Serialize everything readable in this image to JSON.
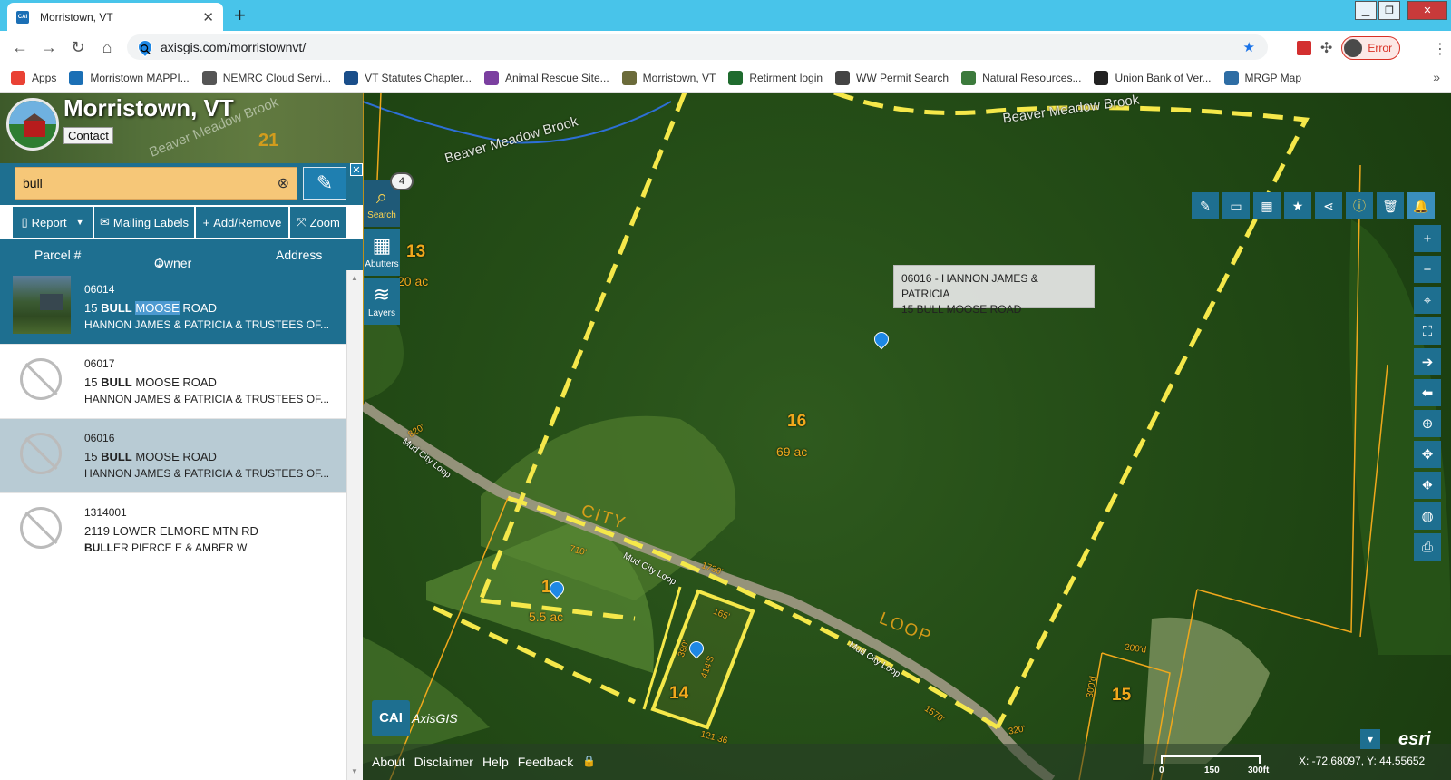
{
  "browser": {
    "tab_title": "Morristown, VT",
    "url": "axisgis.com/morristownvt/",
    "profile_label": "Error",
    "bookmarks": [
      {
        "label": "Apps",
        "color": "#e94235"
      },
      {
        "label": "Morristown MAPPI...",
        "color": "#1b6fb5"
      },
      {
        "label": "NEMRC Cloud Servi...",
        "color": "#555555"
      },
      {
        "label": "VT Statutes Chapter...",
        "color": "#1a4e8a"
      },
      {
        "label": "Animal Rescue Site...",
        "color": "#7b3fa0"
      },
      {
        "label": "Morristown, VT",
        "color": "#6b6b3a"
      },
      {
        "label": "Retirment login",
        "color": "#1f6b2e"
      },
      {
        "label": "WW Permit Search",
        "color": "#444444"
      },
      {
        "label": "Natural Resources...",
        "color": "#3c7a3c"
      },
      {
        "label": "Union Bank of Ver...",
        "color": "#222222"
      },
      {
        "label": "MRGP Map",
        "color": "#2e6da4"
      }
    ]
  },
  "app": {
    "title": "Morristown, VT",
    "contact_label": "Contact",
    "banner_parcel": "21",
    "banner_brook": "Beaver Meadow Brook"
  },
  "search": {
    "value": "bull",
    "result_count": "4"
  },
  "actions": {
    "report": "Report",
    "mailing_labels": "Mailing Labels",
    "add_remove": "Add/Remove",
    "zoom": "Zoom"
  },
  "columns": {
    "parcel": "Parcel #",
    "owner": "Owner",
    "address": "Address"
  },
  "results": [
    {
      "parcel": "06014",
      "address_pre": "15 ",
      "address_bold": "BULL",
      "address_hl": "MOOSE",
      "address_post": " ROAD",
      "owner": "HANNON JAMES & PATRICIA & TRUSTEES OF..."
    },
    {
      "parcel": "06017",
      "address_pre": "15 ",
      "address_bold": "BULL",
      "address_post": " MOOSE ROAD",
      "owner": "HANNON JAMES & PATRICIA & TRUSTEES OF..."
    },
    {
      "parcel": "06016",
      "address_pre": "15 ",
      "address_bold": "BULL",
      "address_post": " MOOSE ROAD",
      "owner": "HANNON JAMES & PATRICIA & TRUSTEES OF..."
    },
    {
      "parcel": "1314001",
      "address": "2119 LOWER ELMORE MTN RD",
      "owner_bold": "BULL",
      "owner_rest": "ER PIERCE E & AMBER W"
    }
  ],
  "tools": {
    "search": "Search",
    "abutters": "Abutters",
    "layers": "Layers"
  },
  "map": {
    "popup_line1": "06016 - HANNON JAMES & PATRICIA",
    "popup_line2": "15 BULL MOOSE ROAD",
    "parcel_13": "13",
    "acres_13": "20   ac",
    "parcel_16": "16",
    "acres_16": "69   ac",
    "parcel_1": "1",
    "acres_1": "5.5   ac",
    "parcel_14": "14",
    "parcel_15": "15",
    "brook_top": "Beaver Meadow Brook",
    "brook_mid": "Beaver Meadow Brook",
    "road_city": "CITY",
    "road_loop": "LOOP",
    "road_mud1": "Mud City Loop",
    "road_mud2": "Mud City Loop",
    "road_mud3": "Mud City Loop",
    "dims": [
      "820'",
      "710'",
      "1730'",
      "165'",
      "390'",
      "414'S",
      "1570'",
      "200'd",
      "300'd",
      "320'",
      "121.36"
    ]
  },
  "footer": {
    "about": "About",
    "disclaimer": "Disclaimer",
    "help": "Help",
    "feedback": "Feedback",
    "scale_0": "0",
    "scale_150": "150",
    "scale_300": "300ft",
    "coords": "X: -72.68097, Y: 44.55652",
    "esri": "esri",
    "cai": "CAI",
    "axisgis": "AxisGIS"
  }
}
